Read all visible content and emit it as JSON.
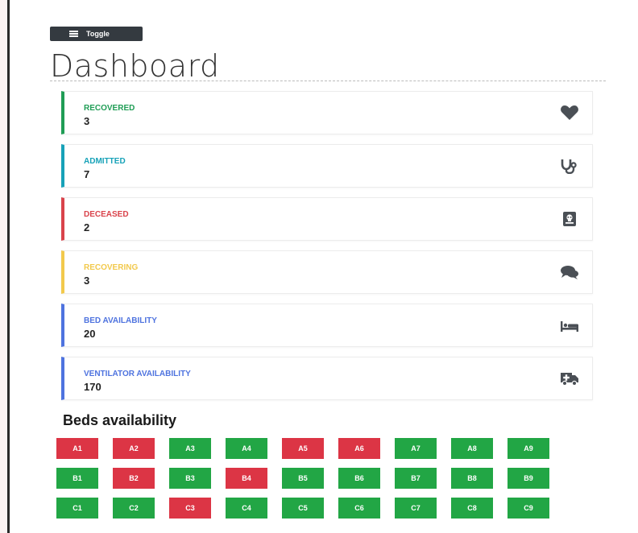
{
  "toggle_label": "Toggle",
  "page_title": "Dashboard",
  "colors": {
    "green": "#1f9d55",
    "teal": "#17a2b8",
    "red": "#d9434b",
    "yellow": "#f2c94c",
    "blue": "#4e73df",
    "icon_gray": "#4a4f55",
    "bed_available": "#22a645",
    "bed_occupied": "#dc3545"
  },
  "cards": [
    {
      "label": "RECOVERED",
      "value": "3",
      "icon": "heart-icon",
      "color": "#1f9d55"
    },
    {
      "label": "ADMITTED",
      "value": "7",
      "icon": "stethoscope-icon",
      "color": "#17a2b8"
    },
    {
      "label": "DECEASED",
      "value": "2",
      "icon": "skull-icon",
      "color": "#d9434b"
    },
    {
      "label": "RECOVERING",
      "value": "3",
      "icon": "comments-icon",
      "color": "#f2c94c"
    },
    {
      "label": "BED AVAILABILITY",
      "value": "20",
      "icon": "bed-icon",
      "color": "#4e73df"
    },
    {
      "label": "VENTILATOR AVAILABILITY",
      "value": "170",
      "icon": "ambulance-icon",
      "color": "#4e73df"
    }
  ],
  "beds_title": "Beds availability",
  "beds": [
    [
      {
        "id": "A1",
        "status": "occupied"
      },
      {
        "id": "A2",
        "status": "occupied"
      },
      {
        "id": "A3",
        "status": "available"
      },
      {
        "id": "A4",
        "status": "available"
      },
      {
        "id": "A5",
        "status": "occupied"
      },
      {
        "id": "A6",
        "status": "occupied"
      },
      {
        "id": "A7",
        "status": "available"
      },
      {
        "id": "A8",
        "status": "available"
      },
      {
        "id": "A9",
        "status": "available"
      }
    ],
    [
      {
        "id": "B1",
        "status": "available"
      },
      {
        "id": "B2",
        "status": "occupied"
      },
      {
        "id": "B3",
        "status": "available"
      },
      {
        "id": "B4",
        "status": "occupied"
      },
      {
        "id": "B5",
        "status": "available"
      },
      {
        "id": "B6",
        "status": "available"
      },
      {
        "id": "B7",
        "status": "available"
      },
      {
        "id": "B8",
        "status": "available"
      },
      {
        "id": "B9",
        "status": "available"
      }
    ],
    [
      {
        "id": "C1",
        "status": "available"
      },
      {
        "id": "C2",
        "status": "available"
      },
      {
        "id": "C3",
        "status": "occupied"
      },
      {
        "id": "C4",
        "status": "available"
      },
      {
        "id": "C5",
        "status": "available"
      },
      {
        "id": "C6",
        "status": "available"
      },
      {
        "id": "C7",
        "status": "available"
      },
      {
        "id": "C8",
        "status": "available"
      },
      {
        "id": "C9",
        "status": "available"
      }
    ]
  ]
}
